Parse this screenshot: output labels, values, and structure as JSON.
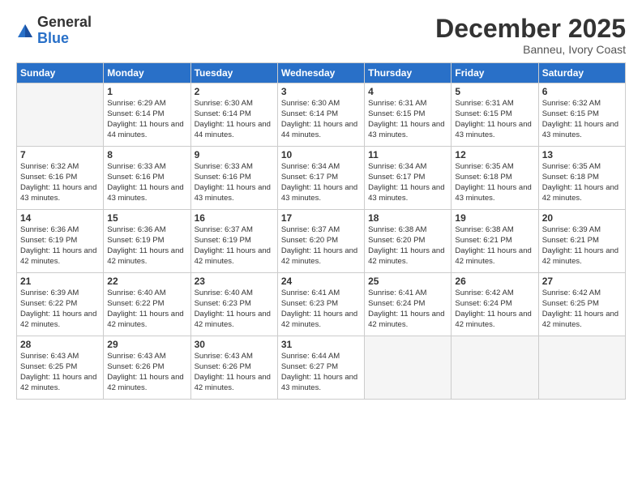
{
  "header": {
    "logo_general": "General",
    "logo_blue": "Blue",
    "month_title": "December 2025",
    "location": "Banneu, Ivory Coast"
  },
  "weekdays": [
    "Sunday",
    "Monday",
    "Tuesday",
    "Wednesday",
    "Thursday",
    "Friday",
    "Saturday"
  ],
  "weeks": [
    [
      {
        "day": "",
        "empty": true
      },
      {
        "day": "1",
        "sunrise": "Sunrise: 6:29 AM",
        "sunset": "Sunset: 6:14 PM",
        "daylight": "Daylight: 11 hours and 44 minutes."
      },
      {
        "day": "2",
        "sunrise": "Sunrise: 6:30 AM",
        "sunset": "Sunset: 6:14 PM",
        "daylight": "Daylight: 11 hours and 44 minutes."
      },
      {
        "day": "3",
        "sunrise": "Sunrise: 6:30 AM",
        "sunset": "Sunset: 6:14 PM",
        "daylight": "Daylight: 11 hours and 44 minutes."
      },
      {
        "day": "4",
        "sunrise": "Sunrise: 6:31 AM",
        "sunset": "Sunset: 6:15 PM",
        "daylight": "Daylight: 11 hours and 43 minutes."
      },
      {
        "day": "5",
        "sunrise": "Sunrise: 6:31 AM",
        "sunset": "Sunset: 6:15 PM",
        "daylight": "Daylight: 11 hours and 43 minutes."
      },
      {
        "day": "6",
        "sunrise": "Sunrise: 6:32 AM",
        "sunset": "Sunset: 6:15 PM",
        "daylight": "Daylight: 11 hours and 43 minutes."
      }
    ],
    [
      {
        "day": "7",
        "sunrise": "Sunrise: 6:32 AM",
        "sunset": "Sunset: 6:16 PM",
        "daylight": "Daylight: 11 hours and 43 minutes."
      },
      {
        "day": "8",
        "sunrise": "Sunrise: 6:33 AM",
        "sunset": "Sunset: 6:16 PM",
        "daylight": "Daylight: 11 hours and 43 minutes."
      },
      {
        "day": "9",
        "sunrise": "Sunrise: 6:33 AM",
        "sunset": "Sunset: 6:16 PM",
        "daylight": "Daylight: 11 hours and 43 minutes."
      },
      {
        "day": "10",
        "sunrise": "Sunrise: 6:34 AM",
        "sunset": "Sunset: 6:17 PM",
        "daylight": "Daylight: 11 hours and 43 minutes."
      },
      {
        "day": "11",
        "sunrise": "Sunrise: 6:34 AM",
        "sunset": "Sunset: 6:17 PM",
        "daylight": "Daylight: 11 hours and 43 minutes."
      },
      {
        "day": "12",
        "sunrise": "Sunrise: 6:35 AM",
        "sunset": "Sunset: 6:18 PM",
        "daylight": "Daylight: 11 hours and 43 minutes."
      },
      {
        "day": "13",
        "sunrise": "Sunrise: 6:35 AM",
        "sunset": "Sunset: 6:18 PM",
        "daylight": "Daylight: 11 hours and 42 minutes."
      }
    ],
    [
      {
        "day": "14",
        "sunrise": "Sunrise: 6:36 AM",
        "sunset": "Sunset: 6:19 PM",
        "daylight": "Daylight: 11 hours and 42 minutes."
      },
      {
        "day": "15",
        "sunrise": "Sunrise: 6:36 AM",
        "sunset": "Sunset: 6:19 PM",
        "daylight": "Daylight: 11 hours and 42 minutes."
      },
      {
        "day": "16",
        "sunrise": "Sunrise: 6:37 AM",
        "sunset": "Sunset: 6:19 PM",
        "daylight": "Daylight: 11 hours and 42 minutes."
      },
      {
        "day": "17",
        "sunrise": "Sunrise: 6:37 AM",
        "sunset": "Sunset: 6:20 PM",
        "daylight": "Daylight: 11 hours and 42 minutes."
      },
      {
        "day": "18",
        "sunrise": "Sunrise: 6:38 AM",
        "sunset": "Sunset: 6:20 PM",
        "daylight": "Daylight: 11 hours and 42 minutes."
      },
      {
        "day": "19",
        "sunrise": "Sunrise: 6:38 AM",
        "sunset": "Sunset: 6:21 PM",
        "daylight": "Daylight: 11 hours and 42 minutes."
      },
      {
        "day": "20",
        "sunrise": "Sunrise: 6:39 AM",
        "sunset": "Sunset: 6:21 PM",
        "daylight": "Daylight: 11 hours and 42 minutes."
      }
    ],
    [
      {
        "day": "21",
        "sunrise": "Sunrise: 6:39 AM",
        "sunset": "Sunset: 6:22 PM",
        "daylight": "Daylight: 11 hours and 42 minutes."
      },
      {
        "day": "22",
        "sunrise": "Sunrise: 6:40 AM",
        "sunset": "Sunset: 6:22 PM",
        "daylight": "Daylight: 11 hours and 42 minutes."
      },
      {
        "day": "23",
        "sunrise": "Sunrise: 6:40 AM",
        "sunset": "Sunset: 6:23 PM",
        "daylight": "Daylight: 11 hours and 42 minutes."
      },
      {
        "day": "24",
        "sunrise": "Sunrise: 6:41 AM",
        "sunset": "Sunset: 6:23 PM",
        "daylight": "Daylight: 11 hours and 42 minutes."
      },
      {
        "day": "25",
        "sunrise": "Sunrise: 6:41 AM",
        "sunset": "Sunset: 6:24 PM",
        "daylight": "Daylight: 11 hours and 42 minutes."
      },
      {
        "day": "26",
        "sunrise": "Sunrise: 6:42 AM",
        "sunset": "Sunset: 6:24 PM",
        "daylight": "Daylight: 11 hours and 42 minutes."
      },
      {
        "day": "27",
        "sunrise": "Sunrise: 6:42 AM",
        "sunset": "Sunset: 6:25 PM",
        "daylight": "Daylight: 11 hours and 42 minutes."
      }
    ],
    [
      {
        "day": "28",
        "sunrise": "Sunrise: 6:43 AM",
        "sunset": "Sunset: 6:25 PM",
        "daylight": "Daylight: 11 hours and 42 minutes."
      },
      {
        "day": "29",
        "sunrise": "Sunrise: 6:43 AM",
        "sunset": "Sunset: 6:26 PM",
        "daylight": "Daylight: 11 hours and 42 minutes."
      },
      {
        "day": "30",
        "sunrise": "Sunrise: 6:43 AM",
        "sunset": "Sunset: 6:26 PM",
        "daylight": "Daylight: 11 hours and 42 minutes."
      },
      {
        "day": "31",
        "sunrise": "Sunrise: 6:44 AM",
        "sunset": "Sunset: 6:27 PM",
        "daylight": "Daylight: 11 hours and 43 minutes."
      },
      {
        "day": "",
        "empty": true
      },
      {
        "day": "",
        "empty": true
      },
      {
        "day": "",
        "empty": true
      }
    ]
  ]
}
